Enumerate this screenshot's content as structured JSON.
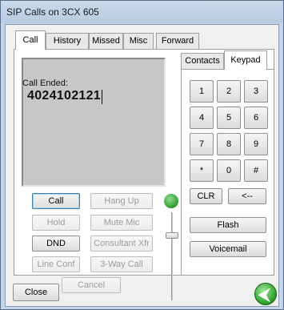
{
  "window": {
    "title": "SIP Calls on 3CX 605"
  },
  "tabs": [
    "Call",
    "History",
    "Missed",
    "Misc",
    "Forward"
  ],
  "active_tab": "Call",
  "display": {
    "status": "Call Ended:",
    "number": "4024102121"
  },
  "call_buttons": {
    "call": "Call",
    "hang_up": "Hang Up",
    "hold": "Hold",
    "mute_mic": "Mute Mic",
    "dnd": "DND",
    "consultant_xfr": "Consultant Xfr",
    "line_conf": "Line Conf",
    "three_way_call": "3-Way Call",
    "cancel": "Cancel"
  },
  "side_tabs": [
    "Contacts",
    "Keypad"
  ],
  "active_side_tab": "Keypad",
  "keypad": {
    "keys": [
      "1",
      "2",
      "3",
      "4",
      "5",
      "6",
      "7",
      "8",
      "9",
      "*",
      "0",
      "#"
    ],
    "clr": "CLR",
    "backspace": "<--",
    "flash": "Flash",
    "voicemail": "Voicemail"
  },
  "footer": {
    "close": "Close",
    "back_icon": "green-back-arrow-icon"
  },
  "colors": {
    "window_frame": "#c4d5e8",
    "display_bg": "#c7c7c7",
    "accent_green": "#36a936"
  }
}
